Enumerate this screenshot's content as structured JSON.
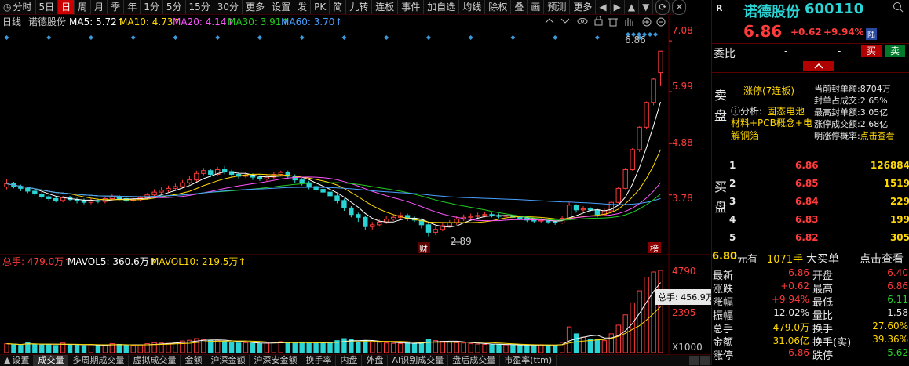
{
  "toolbar": {
    "items": [
      "分时",
      "5日",
      "日",
      "周",
      "月",
      "季",
      "年",
      "1分",
      "5分",
      "15分",
      "30分",
      "更多",
      "设置",
      "发",
      "PK",
      "简",
      "九转",
      "连板",
      "事件",
      "加自选",
      "均线",
      "除权",
      "叠",
      "画",
      "预测",
      "更多"
    ],
    "active_index": 2,
    "nav_icons": [
      "◀",
      "▶",
      "▲",
      "▼"
    ],
    "window_icons": [
      "⟳",
      "✕"
    ]
  },
  "chart_header": {
    "period": "日线",
    "name": "诺德股份",
    "ma5": "MA5: 5.72↑",
    "ma10": "MA10: 4.73↑",
    "ma20": "MA20: 4.14↑",
    "ma30": "MA30: 3.91↑",
    "ma60": "MA60: 3.70↑"
  },
  "price_axis": [
    "7.08",
    "5.99",
    "4.88",
    "3.78"
  ],
  "price_markers": {
    "high": "6.86",
    "low": "2.89",
    "cai": "财",
    "bang": "榜"
  },
  "volume_header": {
    "total": "总手: 479.0万↑",
    "mavol5": "MAVOL5: 360.6万↑",
    "mavol10": "MAVOL10: 219.5万↑"
  },
  "volume_axis": [
    "4790",
    "2395",
    "X1000"
  ],
  "tooltip": "总手: 456.9万",
  "tabs": [
    "设置",
    "成交量",
    "多周期成交量",
    "虚拟成交量",
    "金额",
    "沪深金额",
    "沪深安金额",
    "换手率",
    "内盘",
    "外盘",
    "AI识别成交量",
    "盘后成交量",
    "市盈率(ttm)"
  ],
  "tabs_active_index": 1,
  "quote": {
    "logo": "R",
    "stock_name": "诺德股份",
    "code": "600110",
    "price": "6.86",
    "change": "+0.62",
    "pct": "+9.94%",
    "market_badge": "陆",
    "weibi_label": "委比",
    "weibi_value": "-",
    "weicha_value": "-",
    "buy_btn": "买",
    "sell_btn": "卖",
    "limit_title": "涨停(7连板)",
    "analysis_prefix": "ⓘ分析:",
    "analysis_link": "固态电池",
    "analysis_text": "材料+PCB概念+电解铜箔",
    "side_sell": "卖盘",
    "side_buy": "买盘",
    "seal_rows": [
      {
        "label": "当前封单额:",
        "value": "8704万"
      },
      {
        "label": "封单占成交:",
        "value": "2.65%"
      },
      {
        "label": "最高封单额:",
        "value": "3.05亿"
      },
      {
        "label": "涨停成交额:",
        "value": "2.68亿"
      },
      {
        "label": "明涨停概率:",
        "value": "点击查看"
      }
    ],
    "bids": [
      {
        "n": "1",
        "price": "6.86",
        "vol": "126884"
      },
      {
        "n": "2",
        "price": "6.85",
        "vol": "1519"
      },
      {
        "n": "3",
        "price": "6.84",
        "vol": "229"
      },
      {
        "n": "4",
        "price": "6.83",
        "vol": "199"
      },
      {
        "n": "5",
        "price": "6.82",
        "vol": "305"
      }
    ],
    "big_buy_price": "6.80",
    "big_buy_label": "元有",
    "big_buy_vol": "1071手",
    "big_buy_text": "大买单",
    "big_buy_link": "点击查看",
    "stats": [
      {
        "l1": "最新",
        "v1": "6.86",
        "l2": "开盘",
        "v2": "6.40"
      },
      {
        "l1": "涨跌",
        "v1": "+0.62",
        "l2": "最高",
        "v2": "6.86"
      },
      {
        "l1": "涨幅",
        "v1": "+9.94%",
        "l2": "最低",
        "v2": "6.11"
      },
      {
        "l1": "振幅",
        "v1": "12.02%",
        "l2": "量比",
        "v2": "1.58"
      },
      {
        "l1": "总手",
        "v1": "479.0万",
        "l2": "换手",
        "v2": "27.60%"
      },
      {
        "l1": "金额",
        "v1": "31.06亿",
        "l2": "换手(实)",
        "v2": "39.36%"
      },
      {
        "l1": "涨停",
        "v1": "6.86",
        "l2": "跌停",
        "v2": "5.62"
      }
    ]
  },
  "colors": {
    "up": "#ff3b3b",
    "down": "#2ad4d4",
    "ma5": "#ffffff",
    "ma10": "#ffd800",
    "ma20": "#ff55ff",
    "ma30": "#22cc22",
    "ma60": "#4aa0ff"
  },
  "chart_data": {
    "type": "candlestick",
    "ylim": [
      2.6,
      7.3
    ],
    "candles": [
      [
        3.95,
        4.02,
        4.12,
        3.9
      ],
      [
        4.02,
        3.96,
        4.06,
        3.92
      ],
      [
        3.96,
        3.92,
        4.0,
        3.86
      ],
      [
        3.92,
        3.86,
        3.95,
        3.82
      ],
      [
        3.86,
        3.8,
        3.9,
        3.76
      ],
      [
        3.8,
        3.74,
        3.84,
        3.7
      ],
      [
        3.74,
        3.7,
        3.78,
        3.66
      ],
      [
        3.7,
        3.66,
        3.74,
        3.62
      ],
      [
        3.66,
        3.72,
        3.76,
        3.62
      ],
      [
        3.72,
        3.68,
        3.76,
        3.64
      ],
      [
        3.68,
        3.66,
        3.72,
        3.6
      ],
      [
        3.66,
        3.62,
        3.7,
        3.58
      ],
      [
        3.62,
        3.66,
        3.7,
        3.58
      ],
      [
        3.66,
        3.64,
        3.7,
        3.6
      ],
      [
        3.64,
        3.7,
        3.74,
        3.6
      ],
      [
        3.7,
        3.74,
        3.8,
        3.66
      ],
      [
        3.74,
        3.7,
        3.78,
        3.66
      ],
      [
        3.7,
        3.66,
        3.74,
        3.62
      ],
      [
        3.66,
        3.68,
        3.72,
        3.62
      ],
      [
        3.68,
        3.72,
        3.76,
        3.64
      ],
      [
        3.72,
        3.78,
        3.82,
        3.68
      ],
      [
        3.78,
        3.84,
        3.9,
        3.74
      ],
      [
        3.84,
        3.88,
        3.94,
        3.8
      ],
      [
        3.88,
        3.92,
        3.98,
        3.84
      ],
      [
        3.92,
        3.96,
        4.02,
        3.88
      ],
      [
        3.96,
        4.04,
        4.1,
        3.92
      ],
      [
        4.04,
        4.1,
        4.18,
        4.0
      ],
      [
        4.1,
        4.24,
        4.3,
        4.06
      ],
      [
        4.24,
        4.3,
        4.36,
        4.2
      ],
      [
        4.3,
        4.22,
        4.34,
        4.16
      ],
      [
        4.22,
        4.32,
        4.38,
        4.18
      ],
      [
        4.32,
        4.28,
        4.4,
        4.22
      ],
      [
        4.28,
        4.22,
        4.32,
        4.16
      ],
      [
        4.22,
        4.18,
        4.26,
        4.12
      ],
      [
        4.18,
        4.2,
        4.26,
        4.14
      ],
      [
        4.2,
        4.16,
        4.24,
        4.1
      ],
      [
        4.16,
        4.12,
        4.2,
        4.08
      ],
      [
        4.12,
        4.16,
        4.22,
        4.08
      ],
      [
        4.16,
        4.22,
        4.28,
        4.12
      ],
      [
        4.22,
        4.26,
        4.3,
        4.18
      ],
      [
        4.26,
        4.18,
        4.3,
        4.12
      ],
      [
        4.18,
        4.1,
        4.22,
        4.04
      ],
      [
        4.1,
        4.04,
        4.14,
        3.98
      ],
      [
        4.04,
        3.96,
        4.08,
        3.9
      ],
      [
        3.96,
        3.9,
        4.0,
        3.84
      ],
      [
        3.9,
        3.84,
        3.94,
        3.78
      ],
      [
        3.84,
        3.76,
        3.88,
        3.7
      ],
      [
        3.76,
        3.66,
        3.8,
        3.6
      ],
      [
        3.66,
        3.5,
        3.7,
        3.44
      ],
      [
        3.5,
        3.36,
        3.54,
        3.3
      ],
      [
        3.36,
        3.3,
        3.4,
        3.2
      ],
      [
        3.3,
        3.1,
        3.34,
        3.02
      ],
      [
        3.1,
        3.14,
        3.2,
        3.04
      ],
      [
        3.14,
        3.2,
        3.26,
        3.1
      ],
      [
        3.2,
        3.26,
        3.32,
        3.16
      ],
      [
        3.26,
        3.3,
        3.36,
        3.22
      ],
      [
        3.3,
        3.34,
        3.4,
        3.26
      ],
      [
        3.34,
        3.28,
        3.38,
        3.22
      ],
      [
        3.28,
        3.24,
        3.32,
        3.2
      ],
      [
        3.24,
        3.14,
        3.28,
        3.06
      ],
      [
        3.14,
        2.98,
        3.18,
        2.89
      ],
      [
        2.98,
        3.04,
        3.1,
        2.92
      ],
      [
        3.04,
        3.12,
        3.18,
        3.0
      ],
      [
        3.12,
        3.18,
        3.24,
        3.08
      ],
      [
        3.18,
        3.26,
        3.32,
        3.14
      ],
      [
        3.26,
        3.3,
        3.36,
        3.22
      ],
      [
        3.3,
        3.32,
        3.38,
        3.26
      ],
      [
        3.32,
        3.34,
        3.4,
        3.28
      ],
      [
        3.34,
        3.36,
        3.42,
        3.3
      ],
      [
        3.36,
        3.34,
        3.4,
        3.3
      ],
      [
        3.34,
        3.32,
        3.38,
        3.28
      ],
      [
        3.32,
        3.34,
        3.38,
        3.28
      ],
      [
        3.34,
        3.3,
        3.36,
        3.26
      ],
      [
        3.3,
        3.28,
        3.34,
        3.24
      ],
      [
        3.28,
        3.24,
        3.3,
        3.2
      ],
      [
        3.24,
        3.22,
        3.28,
        3.18
      ],
      [
        3.22,
        3.24,
        3.28,
        3.18
      ],
      [
        3.24,
        3.2,
        3.26,
        3.16
      ],
      [
        3.2,
        3.18,
        3.24,
        3.14
      ],
      [
        3.18,
        3.28,
        3.34,
        3.16
      ],
      [
        3.28,
        3.56,
        3.62,
        3.26
      ],
      [
        3.56,
        3.46,
        3.58,
        3.4
      ],
      [
        3.46,
        3.48,
        3.54,
        3.42
      ],
      [
        3.48,
        3.46,
        3.52,
        3.42
      ],
      [
        3.46,
        3.36,
        3.5,
        3.3
      ],
      [
        3.36,
        3.44,
        3.5,
        3.34
      ],
      [
        3.44,
        3.62,
        3.66,
        3.42
      ],
      [
        3.62,
        3.92,
        3.96,
        3.6
      ],
      [
        3.92,
        4.32,
        4.36,
        3.9
      ],
      [
        4.32,
        4.75,
        4.78,
        4.3
      ],
      [
        4.75,
        5.23,
        5.25,
        4.7
      ],
      [
        5.23,
        5.76,
        5.78,
        5.2
      ],
      [
        5.76,
        6.26,
        6.28,
        5.7
      ],
      [
        6.4,
        6.86,
        6.86,
        6.11
      ]
    ],
    "volumes": [
      520,
      480,
      430,
      610,
      500,
      450,
      480,
      420,
      560,
      480,
      430,
      400,
      470,
      420,
      440,
      520,
      480,
      430,
      410,
      450,
      520,
      580,
      560,
      540,
      600,
      680,
      720,
      820,
      760,
      700,
      720,
      660,
      600,
      560,
      580,
      540,
      520,
      560,
      600,
      640,
      600,
      580,
      620,
      560,
      540,
      580,
      600,
      700,
      820,
      760,
      620,
      700,
      640,
      600,
      560,
      540,
      520,
      560,
      540,
      600,
      760,
      700,
      660,
      620,
      580,
      560,
      520,
      500,
      480,
      460,
      480,
      460,
      440,
      420,
      440,
      420,
      460,
      440,
      420,
      600,
      1500,
      1100,
      900,
      800,
      780,
      700,
      1100,
      1600,
      2200,
      2900,
      3600,
      4400,
      4700,
      4790
    ],
    "ma_series_order": [
      "ma5",
      "ma10",
      "ma20",
      "ma30",
      "ma60"
    ]
  }
}
